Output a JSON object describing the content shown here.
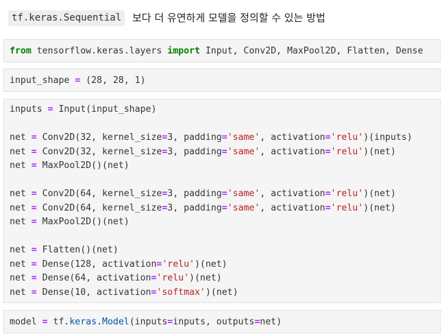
{
  "markdown": {
    "code_label": "tf.keras.Sequential",
    "text": "보다 더 유연하게 모델을 정의할 수 있는 방법"
  },
  "cells": [
    {
      "lines": [
        [
          [
            "kw",
            "from"
          ],
          [
            "plain",
            " tensorflow.keras.layers "
          ],
          [
            "kw",
            "import"
          ],
          [
            "plain",
            " Input, Conv2D, MaxPool2D, Flatten, Dense"
          ]
        ]
      ]
    },
    {
      "lines": [
        [
          [
            "plain",
            "input_shape "
          ],
          [
            "op",
            "="
          ],
          [
            "plain",
            " (28, 28, 1)"
          ]
        ]
      ]
    },
    {
      "lines": [
        [
          [
            "plain",
            "inputs "
          ],
          [
            "op",
            "="
          ],
          [
            "plain",
            " Input(input_shape)"
          ]
        ],
        [],
        [
          [
            "plain",
            "net "
          ],
          [
            "op",
            "="
          ],
          [
            "plain",
            " Conv2D(32, kernel_size"
          ],
          [
            "op",
            "="
          ],
          [
            "plain",
            "3, padding"
          ],
          [
            "op",
            "="
          ],
          [
            "str",
            "'same'"
          ],
          [
            "plain",
            ", activation"
          ],
          [
            "op",
            "="
          ],
          [
            "str",
            "'relu'"
          ],
          [
            "plain",
            ")(inputs)"
          ]
        ],
        [
          [
            "plain",
            "net "
          ],
          [
            "op",
            "="
          ],
          [
            "plain",
            " Conv2D(32, kernel_size"
          ],
          [
            "op",
            "="
          ],
          [
            "plain",
            "3, padding"
          ],
          [
            "op",
            "="
          ],
          [
            "str",
            "'same'"
          ],
          [
            "plain",
            ", activation"
          ],
          [
            "op",
            "="
          ],
          [
            "str",
            "'relu'"
          ],
          [
            "plain",
            ")(net)"
          ]
        ],
        [
          [
            "plain",
            "net "
          ],
          [
            "op",
            "="
          ],
          [
            "plain",
            " MaxPool2D()(net)"
          ]
        ],
        [],
        [
          [
            "plain",
            "net "
          ],
          [
            "op",
            "="
          ],
          [
            "plain",
            " Conv2D(64, kernel_size"
          ],
          [
            "op",
            "="
          ],
          [
            "plain",
            "3, padding"
          ],
          [
            "op",
            "="
          ],
          [
            "str",
            "'same'"
          ],
          [
            "plain",
            ", activation"
          ],
          [
            "op",
            "="
          ],
          [
            "str",
            "'relu'"
          ],
          [
            "plain",
            ")(net)"
          ]
        ],
        [
          [
            "plain",
            "net "
          ],
          [
            "op",
            "="
          ],
          [
            "plain",
            " Conv2D(64, kernel_size"
          ],
          [
            "op",
            "="
          ],
          [
            "plain",
            "3, padding"
          ],
          [
            "op",
            "="
          ],
          [
            "str",
            "'same'"
          ],
          [
            "plain",
            ", activation"
          ],
          [
            "op",
            "="
          ],
          [
            "str",
            "'relu'"
          ],
          [
            "plain",
            ")(net)"
          ]
        ],
        [
          [
            "plain",
            "net "
          ],
          [
            "op",
            "="
          ],
          [
            "plain",
            " MaxPool2D()(net)"
          ]
        ],
        [],
        [
          [
            "plain",
            "net "
          ],
          [
            "op",
            "="
          ],
          [
            "plain",
            " Flatten()(net)"
          ]
        ],
        [
          [
            "plain",
            "net "
          ],
          [
            "op",
            "="
          ],
          [
            "plain",
            " Dense(128, activation"
          ],
          [
            "op",
            "="
          ],
          [
            "str",
            "'relu'"
          ],
          [
            "plain",
            ")(net)"
          ]
        ],
        [
          [
            "plain",
            "net "
          ],
          [
            "op",
            "="
          ],
          [
            "plain",
            " Dense(64, activation"
          ],
          [
            "op",
            "="
          ],
          [
            "str",
            "'relu'"
          ],
          [
            "plain",
            ")(net)"
          ]
        ],
        [
          [
            "plain",
            "net "
          ],
          [
            "op",
            "="
          ],
          [
            "plain",
            " Dense(10, activation"
          ],
          [
            "op",
            "="
          ],
          [
            "str",
            "'softmax'"
          ],
          [
            "plain",
            ")(net)"
          ]
        ]
      ]
    },
    {
      "lines": [
        [
          [
            "plain",
            "model "
          ],
          [
            "op",
            "="
          ],
          [
            "plain",
            " tf."
          ],
          [
            "attr",
            "keras"
          ],
          [
            "plain",
            "."
          ],
          [
            "attr",
            "Model"
          ],
          [
            "plain",
            "(inputs"
          ],
          [
            "op",
            "="
          ],
          [
            "plain",
            "inputs, outputs"
          ],
          [
            "op",
            "="
          ],
          [
            "plain",
            "net)"
          ]
        ]
      ]
    }
  ]
}
